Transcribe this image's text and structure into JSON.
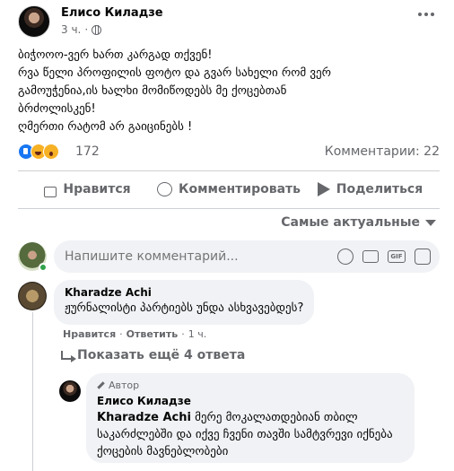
{
  "post": {
    "author": "Елисо Киладзе",
    "time": "3 ч.",
    "text_lines": [
      "ბიჭოოო-ვერ ხართ კარგად თქვენ!",
      "რვა წელი პროფილის ფოტო და გვარ სახელი რომ ვერ",
      "გამოუჭენია,ის ხალხი მომიწოდებს მე ქოცებთან",
      "ბრძოლისკენ!",
      "ღმერთი რატომ არ გაიცინებს !"
    ],
    "reaction_icons": [
      "like-icon",
      "haha-icon",
      "wow-icon"
    ],
    "reaction_count": "172",
    "comments_count": "Комментарии: 22"
  },
  "actions": {
    "like": "Нравится",
    "comment": "Комментировать",
    "share": "Поделиться"
  },
  "sort_label": "Самые актуальные",
  "comment_input": {
    "placeholder": "Напишите комментарий...",
    "icons": [
      "emoji-icon",
      "camera-icon",
      "gif-icon",
      "sticker-icon"
    ],
    "gif_label": "GIF"
  },
  "comment": {
    "author": "Kharadze Achi",
    "text": "ჟურნალისტი პარტიებს უნდა ასხვავებდეს?",
    "like": "Нравится",
    "separator": "·",
    "reply": "Ответить",
    "time": "1 ч."
  },
  "show_more_replies": "Показать ещё 4 ответа",
  "reply": {
    "badge": "Автор",
    "author": "Елисо Киладзе",
    "mention": "Kharadze Achi",
    "text": " მერე მოკალათდებიან თბილ საკარძლებში და იქვე ჩვენი თავში სამტვრევი იქნება ქოცების მავნებლობები"
  }
}
